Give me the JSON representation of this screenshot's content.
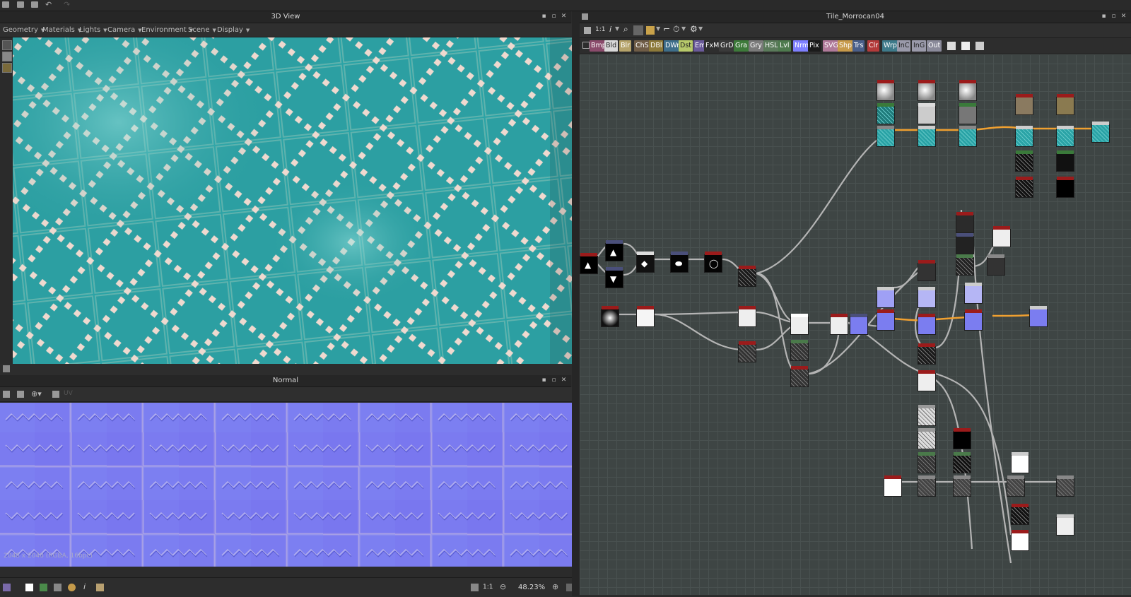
{
  "panels": {
    "view3d": {
      "title": "3D View",
      "menus": [
        "Geometry",
        "Materials",
        "Lights",
        "Camera",
        "Environment",
        "Scene",
        "Display"
      ]
    },
    "normal": {
      "title": "Normal",
      "uv_label": "UV",
      "info": "2048 x 2048 (RGBA, 16bpc)",
      "zoom_ratio": "1:1",
      "zoom": "48.23%"
    },
    "graph": {
      "title": "Tile_Morrocan04",
      "zoom_ratio": "1:1",
      "palette": [
        {
          "label": "Bmp",
          "color": "#8a4b6b"
        },
        {
          "label": "Bld",
          "color": "#d9d9d9"
        },
        {
          "label": "Blr",
          "color": "#b5a36a"
        },
        {
          "label": "ChS",
          "color": "#6f5c46"
        },
        {
          "label": "DBl",
          "color": "#8d7a3a"
        },
        {
          "label": "DWr",
          "color": "#3e6e8a"
        },
        {
          "label": "Dst",
          "color": "#b7c96a"
        },
        {
          "label": "Em",
          "color": "#6a5a9a"
        },
        {
          "label": "FxM",
          "color": "#2e2e2e"
        },
        {
          "label": "GrD",
          "color": "#3a3a3a"
        },
        {
          "label": "Gra",
          "color": "#3d7a3a"
        },
        {
          "label": "Gry",
          "color": "#7a7a7a"
        },
        {
          "label": "HSL",
          "color": "#5a7a5a"
        },
        {
          "label": "Lvl",
          "color": "#4e7a4e"
        },
        {
          "label": "Nrm",
          "color": "#7e80ff"
        },
        {
          "label": "Pix",
          "color": "#1b1b1b"
        },
        {
          "label": "SVG",
          "color": "#b07a9a"
        },
        {
          "label": "Shp",
          "color": "#c79a4a"
        },
        {
          "label": "Trs",
          "color": "#4a5f8a"
        },
        {
          "label": "Clr",
          "color": "#b33a3a"
        },
        {
          "label": "Wrp",
          "color": "#3e7a8a"
        },
        {
          "label": "InC",
          "color": "#9a9aaa"
        },
        {
          "label": "InG",
          "color": "#9a9aaa"
        },
        {
          "label": "Out",
          "color": "#8a8a9a"
        }
      ]
    }
  },
  "colors": {
    "tile_teal": "#2a9ea0",
    "normal_blue": "#7b7df0",
    "graph_bg": "#3e4544",
    "edge_highlight": "#f0a030",
    "edge_default": "#b0b0b0"
  }
}
